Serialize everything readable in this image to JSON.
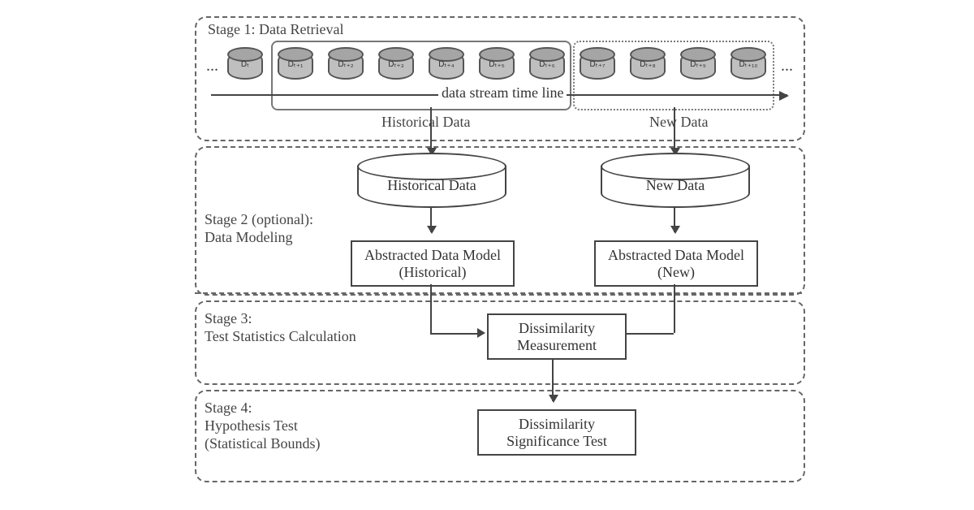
{
  "stages": {
    "s1": {
      "title": "Stage 1: Data Retrieval"
    },
    "s2": {
      "title": "Stage 2 (optional):",
      "subtitle": "Data Modeling"
    },
    "s3": {
      "title": "Stage 3:",
      "subtitle": "Test Statistics Calculation"
    },
    "s4": {
      "title": "Stage 4:",
      "subtitle": "Hypothesis Test",
      "subtitle2": "(Statistical Bounds)"
    }
  },
  "cylinders": {
    "c0": "Dₜ",
    "c1": "Dₜ₊₁",
    "c2": "Dₜ₊₂",
    "c3": "Dₜ₊₃",
    "c4": "Dₜ₊₄",
    "c5": "Dₜ₊₅",
    "c6": "Dₜ₊₆",
    "c7": "Dₜ₊₇",
    "c8": "Dₜ₊₈",
    "c9": "Dₜ₊₉",
    "c10": "Dₜ₊₁₀"
  },
  "labels": {
    "ellipsis": "...",
    "timeline": "data stream time line",
    "historical": "Historical Data",
    "newdata": "New Data",
    "abstracted_hist": "Abstracted Data Model (Historical)",
    "abstracted_new": "Abstracted Data Model (New)",
    "dissim_measure": "Dissimilarity Measurement",
    "dissim_sig": "Dissimilarity Significance Test"
  }
}
